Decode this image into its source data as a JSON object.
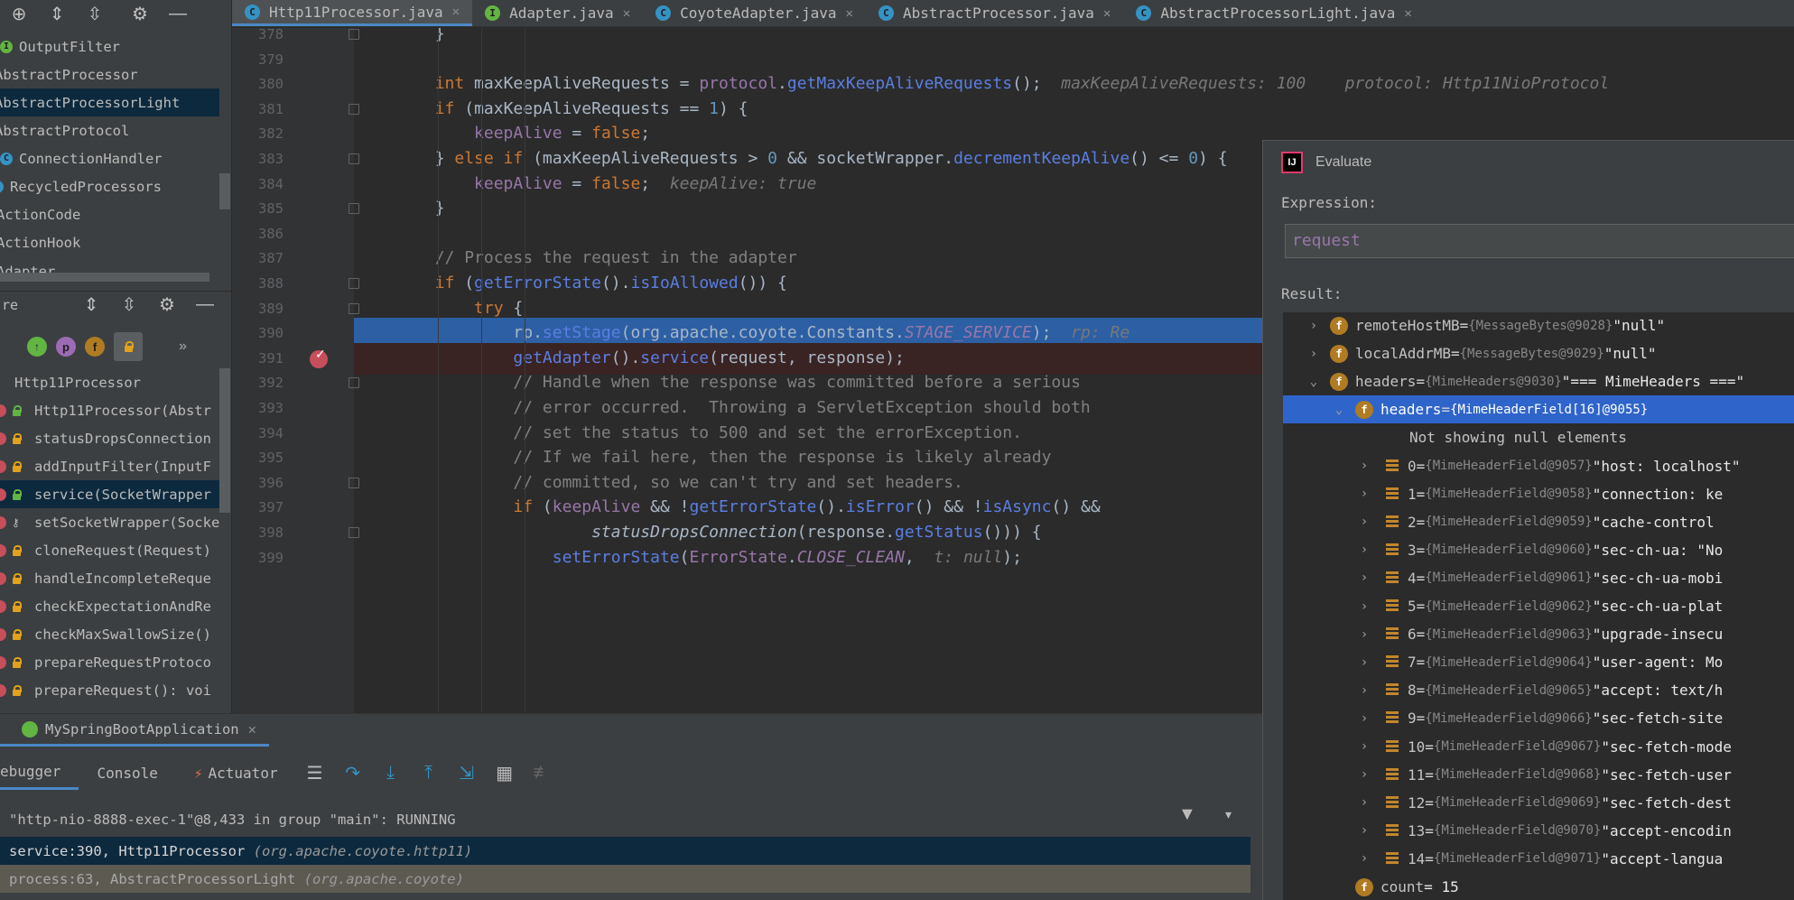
{
  "tabs": [
    {
      "label": "Http11Processor.java",
      "icon": "C"
    },
    {
      "label": "Adapter.java",
      "icon": "I"
    },
    {
      "label": "CoyoteAdapter.java",
      "icon": "C"
    },
    {
      "label": "AbstractProcessor.java",
      "icon": "C"
    },
    {
      "label": "AbstractProcessorLight.java",
      "icon": "C"
    }
  ],
  "project_tree": [
    "OutputFilter",
    "AbstractProcessor",
    "AbstractProcessorLight",
    "AbstractProtocol",
    "ConnectionHandler",
    "RecycledProcessors",
    "ActionCode",
    "ActionHook",
    "Adapter"
  ],
  "structure": {
    "header_label": "re",
    "filter_badges": [
      "↑",
      "p",
      "f"
    ],
    "more": "»",
    "class_name": "Http11Processor",
    "members": [
      "Http11Processor(Abstr",
      "statusDropsConnection",
      "addInputFilter(InputF",
      "service(SocketWrapper",
      "setSocketWrapper(Socke",
      "cloneRequest(Request)",
      "handleIncompleteReque",
      "checkExpectationAndRe",
      "checkMaxSwallowSize()",
      "prepareRequestProtoco",
      "prepareRequest(): voi"
    ]
  },
  "editor": {
    "line_numbers": [
      "378",
      "379",
      "380",
      "381",
      "382",
      "383",
      "384",
      "385",
      "386",
      "387",
      "388",
      "389",
      "390",
      "391",
      "392",
      "393",
      "394",
      "395",
      "396",
      "397",
      "398",
      "399"
    ],
    "inline_values": {
      "l380a": "maxKeepAliveRequests: 100",
      "l380b": "protocol: Http11NioProtocol",
      "l384": "keepAlive: true",
      "l390": "rp: Re",
      "l399": "t: null"
    }
  },
  "evaluate": {
    "title": "Evaluate",
    "expression_label": "Expression:",
    "expression": "request",
    "result_label": "Result:",
    "rows": [
      {
        "name": "remoteHostMB",
        "type": "{MessageBytes@9028}",
        "value": "\"null\""
      },
      {
        "name": "localAddrMB",
        "type": "{MessageBytes@9029}",
        "value": "\"null\""
      },
      {
        "name": "headers",
        "type": "{MimeHeaders@9030}",
        "value": "\"=== MimeHeaders ===\""
      },
      {
        "name": "headers",
        "type": "{MimeHeaderField[16]@9055}",
        "value": ""
      },
      {
        "name": "Not showing null elements",
        "type": "",
        "value": ""
      },
      {
        "name": "0",
        "type": "{MimeHeaderField@9057}",
        "value": "\"host: localhost\""
      },
      {
        "name": "1",
        "type": "{MimeHeaderField@9058}",
        "value": "\"connection: ke"
      },
      {
        "name": "2",
        "type": "{MimeHeaderField@9059}",
        "value": "\"cache-control"
      },
      {
        "name": "3",
        "type": "{MimeHeaderField@9060}",
        "value": "\"sec-ch-ua: \"No"
      },
      {
        "name": "4",
        "type": "{MimeHeaderField@9061}",
        "value": "\"sec-ch-ua-mobi"
      },
      {
        "name": "5",
        "type": "{MimeHeaderField@9062}",
        "value": "\"sec-ch-ua-plat"
      },
      {
        "name": "6",
        "type": "{MimeHeaderField@9063}",
        "value": "\"upgrade-insecu"
      },
      {
        "name": "7",
        "type": "{MimeHeaderField@9064}",
        "value": "\"user-agent: Mo"
      },
      {
        "name": "8",
        "type": "{MimeHeaderField@9065}",
        "value": "\"accept: text/h"
      },
      {
        "name": "9",
        "type": "{MimeHeaderField@9066}",
        "value": "\"sec-fetch-site"
      },
      {
        "name": "10",
        "type": "{MimeHeaderField@9067}",
        "value": "\"sec-fetch-mode"
      },
      {
        "name": "11",
        "type": "{MimeHeaderField@9068}",
        "value": "\"sec-fetch-user"
      },
      {
        "name": "12",
        "type": "{MimeHeaderField@9069}",
        "value": "\"sec-fetch-dest"
      },
      {
        "name": "13",
        "type": "{MimeHeaderField@9070}",
        "value": "\"accept-encodin"
      },
      {
        "name": "14",
        "type": "{MimeHeaderField@9071}",
        "value": "\"accept-langua"
      },
      {
        "name": "count",
        "type": "",
        "value": "= 15"
      }
    ]
  },
  "debug": {
    "run_config": "MySpringBootApplication",
    "tabs": [
      "ebugger",
      "Console",
      "Actuator"
    ],
    "thread": "\"http-nio-8888-exec-1\"@8,433 in group \"main\": RUNNING",
    "frames": [
      {
        "method": "service:390, Http11Processor",
        "pkg": "(org.apache.coyote.http11)"
      },
      {
        "method": "process:63, AbstractProcessorLight",
        "pkg": "(org.apache.coyote)"
      }
    ]
  },
  "colors": {
    "exec_line": "#2d5fa4",
    "breakpoint_line": "#3a2323",
    "selected_result": "#2f65ca",
    "accent": "#4a88c7"
  }
}
